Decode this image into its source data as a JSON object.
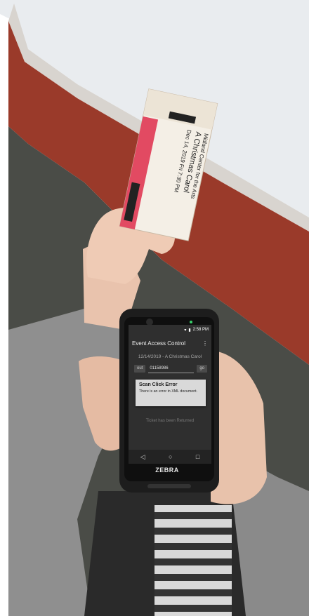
{
  "phone": {
    "status_time": "2:58 PM",
    "app_title": "Event Access Control",
    "event_line": "12/14/2019 - A Christmas Carol",
    "mode_label": "out",
    "ticket_value": "01158986",
    "go_label": "go",
    "result_text": "Ticket has been Returned",
    "brand": "ZEBRA",
    "nav": {
      "back": "◁",
      "home": "○",
      "recent": "□"
    },
    "menu_icon": "⋮"
  },
  "dialog": {
    "title": "Scan Click Error",
    "message": "There is an error in XML document."
  },
  "ticket": {
    "line1": "Midland Center for the Arts",
    "line2": "A Christmas Carol",
    "line3": "Dec 14, 2019 Fri 7:30 PM"
  },
  "colors": {
    "wall": "#e9ecef",
    "carpet": "#4a4c47",
    "red_wall": "#9a3a2a",
    "skin": "#e9c3ad",
    "sleeve": "#8f8f8f",
    "phone_body": "#1d1d1d"
  }
}
